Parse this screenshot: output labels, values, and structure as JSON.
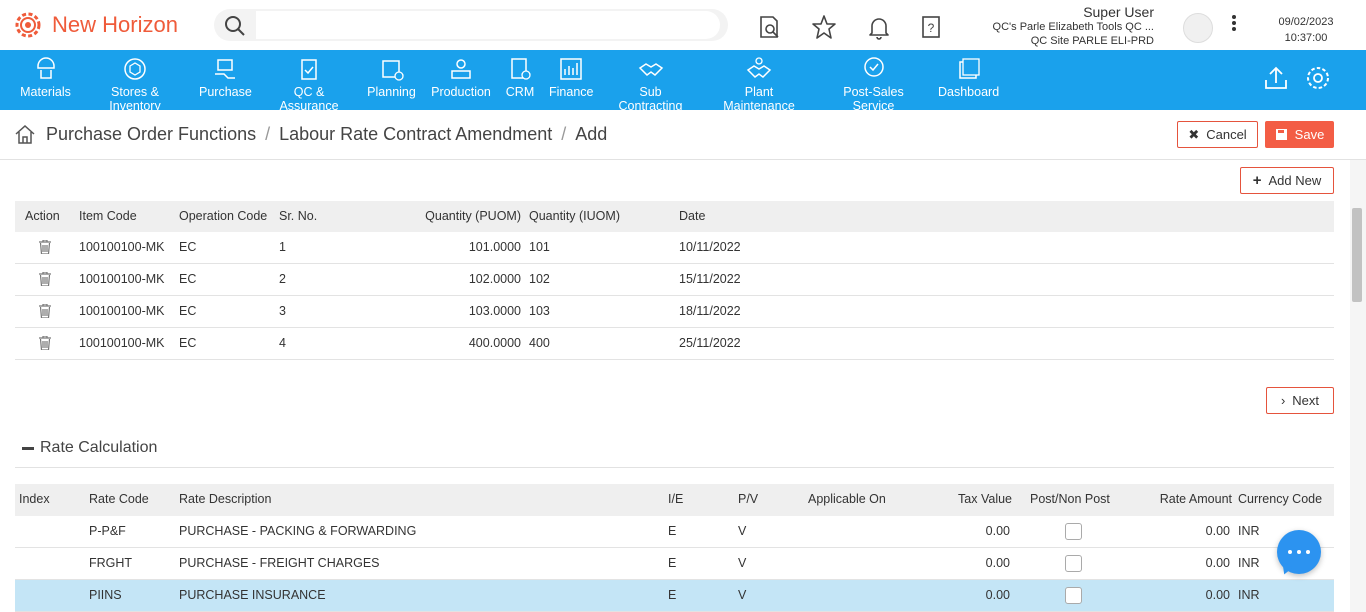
{
  "app": {
    "title": "New Horizon"
  },
  "search": {
    "placeholder": ""
  },
  "user": {
    "name": "Super User",
    "company": "QC's Parle Elizabeth Tools QC ...",
    "site": "QC Site PARLE ELI-PRD",
    "date": "09/02/2023",
    "time": "10:37:00"
  },
  "nav": {
    "items": [
      "Materials",
      "Stores & Inventory",
      "Purchase",
      "QC & Assurance",
      "Planning",
      "Production",
      "CRM",
      "Finance",
      "Sub Contracting",
      "Plant Maintenance",
      "Post-Sales Service",
      "Dashboard"
    ]
  },
  "breadcrumb": {
    "items": [
      "Purchase Order Functions",
      "Labour Rate Contract Amendment",
      "Add"
    ]
  },
  "actions": {
    "cancel": "Cancel",
    "save": "Save",
    "add_new": "Add New",
    "next": "Next"
  },
  "schedule_table": {
    "headers": [
      "Action",
      "Item Code",
      "Operation Code",
      "Sr. No.",
      "Quantity (PUOM)",
      "Quantity (IUOM)",
      "Date"
    ],
    "rows": [
      {
        "item_code": "100100100-MK",
        "op_code": "EC",
        "sr_no": "1",
        "qty_puom": "101.0000",
        "qty_iuom": "101",
        "date": "10/11/2022"
      },
      {
        "item_code": "100100100-MK",
        "op_code": "EC",
        "sr_no": "2",
        "qty_puom": "102.0000",
        "qty_iuom": "102",
        "date": "15/11/2022"
      },
      {
        "item_code": "100100100-MK",
        "op_code": "EC",
        "sr_no": "3",
        "qty_puom": "103.0000",
        "qty_iuom": "103",
        "date": "18/11/2022"
      },
      {
        "item_code": "100100100-MK",
        "op_code": "EC",
        "sr_no": "4",
        "qty_puom": "400.0000",
        "qty_iuom": "400",
        "date": "25/11/2022"
      }
    ]
  },
  "rate_section": {
    "title": "Rate Calculation",
    "headers": [
      "Index",
      "Rate Code",
      "Rate Description",
      "I/E",
      "P/V",
      "Applicable On",
      "Tax Value",
      "Post/Non Post",
      "Rate Amount",
      "Currency Code"
    ],
    "rows": [
      {
        "index": "",
        "rate_code": "P-P&F",
        "description": "PURCHASE - PACKING & FORWARDING",
        "ie": "E",
        "pv": "V",
        "applicable_on": "",
        "tax_value": "0.00",
        "post": false,
        "rate_amount": "0.00",
        "currency": "INR"
      },
      {
        "index": "",
        "rate_code": "FRGHT",
        "description": "PURCHASE - FREIGHT CHARGES",
        "ie": "E",
        "pv": "V",
        "applicable_on": "",
        "tax_value": "0.00",
        "post": false,
        "rate_amount": "0.00",
        "currency": "INR"
      },
      {
        "index": "",
        "rate_code": "PIINS",
        "description": "PURCHASE INSURANCE",
        "ie": "E",
        "pv": "V",
        "applicable_on": "",
        "tax_value": "0.00",
        "post": false,
        "rate_amount": "0.00",
        "currency": "INR"
      }
    ]
  },
  "colors": {
    "brand": "#ef5b3a",
    "nav_bg": "#1aa1ec",
    "save_bg": "#f35d45",
    "selected_row": "#c4e5f6",
    "chat": "#2c93f0"
  }
}
